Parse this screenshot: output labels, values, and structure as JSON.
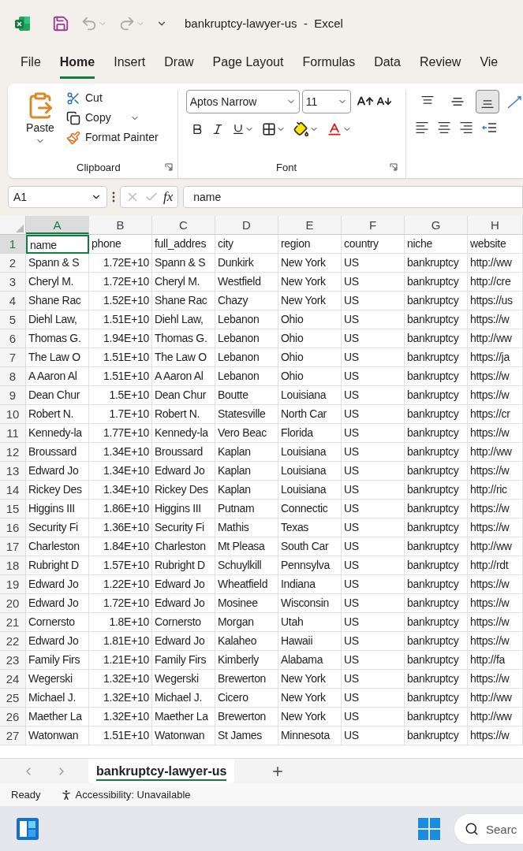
{
  "window": {
    "title": "bankruptcy-lawyer-us  -  Excel"
  },
  "menu_tabs": [
    {
      "label": "File",
      "selected": false
    },
    {
      "label": "Home",
      "selected": true
    },
    {
      "label": "Insert",
      "selected": false
    },
    {
      "label": "Draw",
      "selected": false
    },
    {
      "label": "Page Layout",
      "selected": false
    },
    {
      "label": "Formulas",
      "selected": false
    },
    {
      "label": "Data",
      "selected": false
    },
    {
      "label": "Review",
      "selected": false
    },
    {
      "label": "Vie",
      "selected": false
    }
  ],
  "clipboard": {
    "paste": "Paste",
    "cut": "Cut",
    "copy": "Copy",
    "format_painter": "Format Painter",
    "group_label": "Clipboard"
  },
  "font": {
    "name": "Aptos Narrow",
    "size": "11",
    "group_label": "Font"
  },
  "vertical_alignment": [
    {
      "kind": "top",
      "selected": false
    },
    {
      "kind": "middle",
      "selected": false
    },
    {
      "kind": "bottom",
      "selected": true
    }
  ],
  "formula_bar": {
    "name_box": "A1",
    "fx": "fx",
    "value": "name"
  },
  "columns": [
    {
      "label": "A",
      "selected": true,
      "numeric": false
    },
    {
      "label": "B",
      "selected": false,
      "numeric": true
    },
    {
      "label": "C",
      "selected": false,
      "numeric": false
    },
    {
      "label": "D",
      "selected": false,
      "numeric": false
    },
    {
      "label": "E",
      "selected": false,
      "numeric": false
    },
    {
      "label": "F",
      "selected": false,
      "numeric": false
    },
    {
      "label": "G",
      "selected": false,
      "numeric": false
    },
    {
      "label": "H",
      "selected": false,
      "numeric": false
    }
  ],
  "rows": [
    {
      "number": "1",
      "selected": true,
      "cells": [
        "name",
        "phone",
        "full_addres",
        "city",
        "region",
        "country",
        "niche",
        "website"
      ]
    },
    {
      "number": "2",
      "selected": false,
      "cells": [
        "Spann & S",
        "1.72E+10",
        "Spann & S",
        "Dunkirk",
        "New York",
        "US",
        "bankruptcy",
        "http://ww"
      ]
    },
    {
      "number": "3",
      "selected": false,
      "cells": [
        "Cheryl M.",
        "1.72E+10",
        "Cheryl M.",
        "Westfield",
        "New York",
        "US",
        "bankruptcy",
        "http://cre"
      ]
    },
    {
      "number": "4",
      "selected": false,
      "cells": [
        "Shane Rac",
        "1.52E+10",
        "Shane Rac",
        "Chazy",
        "New York",
        "US",
        "bankruptcy",
        "https://us"
      ]
    },
    {
      "number": "5",
      "selected": false,
      "cells": [
        "Diehl Law,",
        "1.51E+10",
        "Diehl Law,",
        "Lebanon",
        "Ohio",
        "US",
        "bankruptcy",
        "https://w"
      ]
    },
    {
      "number": "6",
      "selected": false,
      "cells": [
        "Thomas G.",
        "1.94E+10",
        "Thomas G.",
        "Lebanon",
        "Ohio",
        "US",
        "bankruptcy",
        "http://ww"
      ]
    },
    {
      "number": "7",
      "selected": false,
      "cells": [
        "The Law O",
        "1.51E+10",
        "The Law O",
        "Lebanon",
        "Ohio",
        "US",
        "bankruptcy",
        "https://ja"
      ]
    },
    {
      "number": "8",
      "selected": false,
      "cells": [
        "A Aaron Al",
        "1.51E+10",
        "A Aaron Al",
        "Lebanon",
        "Ohio",
        "US",
        "bankruptcy",
        "https://w"
      ]
    },
    {
      "number": "9",
      "selected": false,
      "cells": [
        "Dean Chur",
        "1.5E+10",
        "Dean Chur",
        "Boutte",
        "Louisiana",
        "US",
        "bankruptcy",
        "https://w"
      ]
    },
    {
      "number": "10",
      "selected": false,
      "cells": [
        "Robert N.",
        "1.7E+10",
        "Robert N.",
        "Statesville",
        "North Car",
        "US",
        "bankruptcy",
        "https://cr"
      ]
    },
    {
      "number": "11",
      "selected": false,
      "cells": [
        "Kennedy-la",
        "1.77E+10",
        "Kennedy-la",
        "Vero Beac",
        "Florida",
        "US",
        "bankruptcy",
        "https://w"
      ]
    },
    {
      "number": "12",
      "selected": false,
      "cells": [
        "Broussard",
        "1.34E+10",
        "Broussard",
        "Kaplan",
        "Louisiana",
        "US",
        "bankruptcy",
        "http://ww"
      ]
    },
    {
      "number": "13",
      "selected": false,
      "cells": [
        "Edward Jo",
        "1.34E+10",
        "Edward Jo",
        "Kaplan",
        "Louisiana",
        "US",
        "bankruptcy",
        "https://w"
      ]
    },
    {
      "number": "14",
      "selected": false,
      "cells": [
        "Rickey Des",
        "1.34E+10",
        "Rickey Des",
        "Kaplan",
        "Louisiana",
        "US",
        "bankruptcy",
        "http://ric"
      ]
    },
    {
      "number": "15",
      "selected": false,
      "cells": [
        "Higgins III",
        "1.86E+10",
        "Higgins III",
        "Putnam",
        "Connectic",
        "US",
        "bankruptcy",
        "https://w"
      ]
    },
    {
      "number": "16",
      "selected": false,
      "cells": [
        "Security Fi",
        "1.36E+10",
        "Security Fi",
        "Mathis",
        "Texas",
        "US",
        "bankruptcy",
        "https://w"
      ]
    },
    {
      "number": "17",
      "selected": false,
      "cells": [
        "Charleston",
        "1.84E+10",
        "Charleston",
        "Mt Pleasa",
        "South Car",
        "US",
        "bankruptcy",
        "http://ww"
      ]
    },
    {
      "number": "18",
      "selected": false,
      "cells": [
        "Rubright D",
        "1.57E+10",
        "Rubright D",
        "Schuylkill",
        "Pennsylva",
        "US",
        "bankruptcy",
        "http://rdt"
      ]
    },
    {
      "number": "19",
      "selected": false,
      "cells": [
        "Edward Jo",
        "1.22E+10",
        "Edward Jo",
        "Wheatfield",
        "Indiana",
        "US",
        "bankruptcy",
        "https://w"
      ]
    },
    {
      "number": "20",
      "selected": false,
      "cells": [
        "Edward Jo",
        "1.72E+10",
        "Edward Jo",
        "Mosinee",
        "Wisconsin",
        "US",
        "bankruptcy",
        "https://w"
      ]
    },
    {
      "number": "21",
      "selected": false,
      "cells": [
        "Cornersto",
        "1.8E+10",
        "Cornersto",
        "Morgan",
        "Utah",
        "US",
        "bankruptcy",
        "https://w"
      ]
    },
    {
      "number": "22",
      "selected": false,
      "cells": [
        "Edward Jo",
        "1.81E+10",
        "Edward Jo",
        "Kalaheo",
        "Hawaii",
        "US",
        "bankruptcy",
        "https://w"
      ]
    },
    {
      "number": "23",
      "selected": false,
      "cells": [
        "Family Firs",
        "1.21E+10",
        "Family Firs",
        "Kimberly",
        "Alabama",
        "US",
        "bankruptcy",
        "http://fa"
      ]
    },
    {
      "number": "24",
      "selected": false,
      "cells": [
        "Wegerski",
        "1.32E+10",
        "Wegerski",
        "Brewerton",
        "New York",
        "US",
        "bankruptcy",
        "https://w"
      ]
    },
    {
      "number": "25",
      "selected": false,
      "cells": [
        "Michael J.",
        "1.32E+10",
        "Michael J.",
        "Cicero",
        "New York",
        "US",
        "bankruptcy",
        "http://ww"
      ]
    },
    {
      "number": "26",
      "selected": false,
      "cells": [
        "Maether La",
        "1.32E+10",
        "Maether La",
        "Brewerton",
        "New York",
        "US",
        "bankruptcy",
        "http://ww"
      ]
    },
    {
      "number": "27",
      "selected": false,
      "cells": [
        "Watonwan",
        "1.51E+10",
        "Watonwan",
        "St James",
        "Minnesota",
        "US",
        "bankruptcy",
        "https://w"
      ]
    }
  ],
  "sheet_tabs": [
    {
      "label": "bankruptcy-lawyer-us",
      "selected": true
    }
  ],
  "status_bar": {
    "mode": "Ready",
    "accessibility": "Accessibility: Unavailable"
  },
  "taskbar": {
    "search": {
      "placeholder": "Searc"
    }
  }
}
